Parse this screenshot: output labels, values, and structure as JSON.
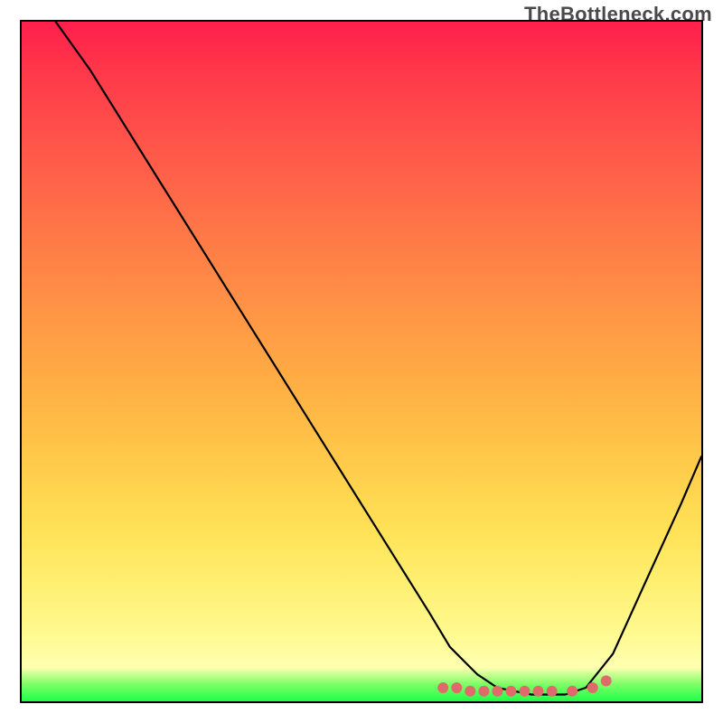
{
  "watermark": "TheBottleneck.com",
  "chart_data": {
    "type": "line",
    "title": "",
    "xlabel": "",
    "ylabel": "",
    "xlim": [
      0,
      100
    ],
    "ylim": [
      0,
      100
    ],
    "grid": false,
    "legend": false,
    "background_gradient": {
      "orientation": "vertical",
      "stops": [
        {
          "pos": 0,
          "color": "#ff1f4b"
        },
        {
          "pos": 0.5,
          "color": "#ffb244"
        },
        {
          "pos": 0.9,
          "color": "#fff98f"
        },
        {
          "pos": 0.97,
          "color": "#7dff66"
        },
        {
          "pos": 1.0,
          "color": "#1fff47"
        }
      ]
    },
    "series": [
      {
        "name": "main-curve",
        "color": "#000000",
        "x": [
          5,
          10,
          15,
          20,
          25,
          30,
          35,
          40,
          45,
          50,
          55,
          60,
          63,
          67,
          70,
          75,
          80,
          83,
          87,
          92,
          97,
          100
        ],
        "y": [
          100,
          93,
          85,
          77,
          69,
          61,
          53,
          45,
          37,
          29,
          21,
          13,
          8,
          4,
          2,
          1,
          1,
          2,
          7,
          18,
          29,
          36
        ]
      },
      {
        "name": "highlight-dots",
        "color": "#e06a6a",
        "type": "scatter",
        "x": [
          62,
          64,
          66,
          68,
          70,
          72,
          74,
          76,
          78,
          81,
          84,
          86
        ],
        "y": [
          2,
          2,
          1.5,
          1.5,
          1.5,
          1.5,
          1.5,
          1.5,
          1.5,
          1.5,
          2,
          3
        ]
      }
    ]
  }
}
